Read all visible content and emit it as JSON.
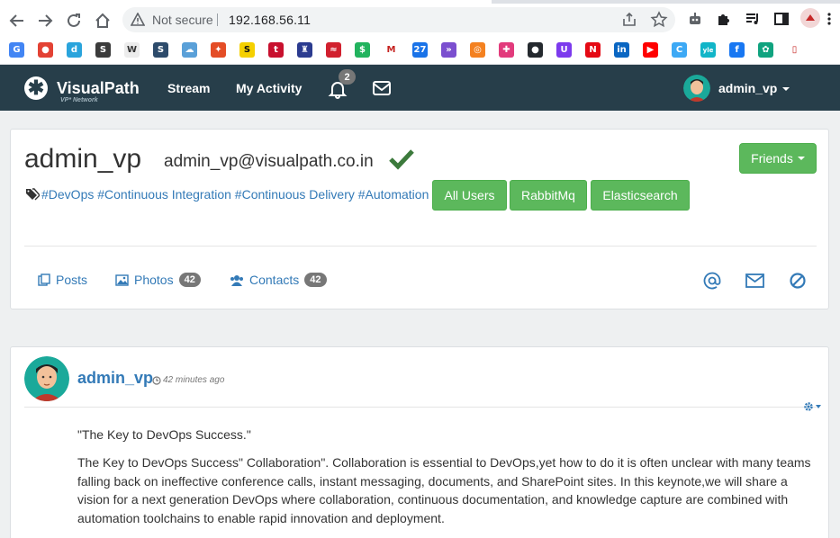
{
  "browser": {
    "security_label": "Not secure",
    "url": "192.168.56.11",
    "bookmarks": [
      {
        "icon": "google-translate-icon",
        "color": "#4285f4",
        "glyph": "G"
      },
      {
        "icon": "red-circle-icon",
        "color": "#e34234",
        "glyph": "●"
      },
      {
        "icon": "d-icon",
        "color": "#2aa4dc",
        "glyph": "d"
      },
      {
        "icon": "s-icon",
        "color": "#3b3b3b",
        "glyph": "S"
      },
      {
        "icon": "w-icon",
        "color": "#ececec",
        "glyph": "W"
      },
      {
        "icon": "stackshare-icon",
        "color": "#2d4b6b",
        "glyph": "S"
      },
      {
        "icon": "cloud-icon",
        "color": "#5aa0d8",
        "glyph": "☁"
      },
      {
        "icon": "leaf-icon",
        "color": "#e44d26",
        "glyph": "✦"
      },
      {
        "icon": "s-yellow-icon",
        "color": "#f5d000",
        "glyph": "S"
      },
      {
        "icon": "tt-icon",
        "color": "#c8102e",
        "glyph": "t"
      },
      {
        "icon": "chess-icon",
        "color": "#2b3b8f",
        "glyph": "♜"
      },
      {
        "icon": "red-wave-icon",
        "color": "#d1202e",
        "glyph": "≈"
      },
      {
        "icon": "dollar-icon",
        "color": "#22b35e",
        "glyph": "$"
      },
      {
        "icon": "gmail-icon",
        "color": "#ffffff",
        "glyph": "M"
      },
      {
        "icon": "calendar-icon",
        "color": "#1a73e8",
        "glyph": "27"
      },
      {
        "icon": "chevrons-icon",
        "color": "#7b4fcf",
        "glyph": "»"
      },
      {
        "icon": "orange-cloud-icon",
        "color": "#f48120",
        "glyph": "◎"
      },
      {
        "icon": "puzzle-bookmark-icon",
        "color": "#e23b7c",
        "glyph": "✚"
      },
      {
        "icon": "github-icon",
        "color": "#24292e",
        "glyph": "●"
      },
      {
        "icon": "u-icon",
        "color": "#7c3aed",
        "glyph": "U"
      },
      {
        "icon": "netflix-icon",
        "color": "#e50914",
        "glyph": "N"
      },
      {
        "icon": "linkedin-icon",
        "color": "#0a66c2",
        "glyph": "in"
      },
      {
        "icon": "youtube-icon",
        "color": "#ff0000",
        "glyph": "▶"
      },
      {
        "icon": "c-icon",
        "color": "#3da9f5",
        "glyph": "C"
      },
      {
        "icon": "yle-icon",
        "color": "#11b5c8",
        "glyph": "yle"
      },
      {
        "icon": "facebook-icon",
        "color": "#1877f2",
        "glyph": "f"
      },
      {
        "icon": "openai-icon",
        "color": "#10a37f",
        "glyph": "✿"
      },
      {
        "icon": "doc-icon",
        "color": "#ffffff",
        "glyph": "▯"
      }
    ]
  },
  "site": {
    "brand": "VisualPath",
    "brand_sub": "VP* Network",
    "nav": {
      "stream": "Stream",
      "activity": "My Activity"
    },
    "notification_count": "2",
    "username": "admin_vp"
  },
  "profile": {
    "name": "admin_vp",
    "email": "admin_vp@visualpath.co.in",
    "friends_label": "Friends",
    "tags": "#DevOps #Continuous Integration #Continuous Delivery #Automation",
    "tag_buttons": [
      "All Users",
      "RabbitMq",
      "Elasticsearch"
    ],
    "tabs": {
      "posts": "Posts",
      "photos": "Photos",
      "photos_count": "42",
      "contacts": "Contacts",
      "contacts_count": "42"
    }
  },
  "post": {
    "author": "admin_vp",
    "time": "42 minutes ago",
    "title": "\"The Key to DevOps Success.\"",
    "body": "The Key to DevOps Success\" Collaboration\". Collaboration is essential to DevOps,yet how to do it is often unclear with many teams falling back on ineffective conference calls, instant messaging, documents, and SharePoint sites. In this keynote,we will share a vision for a next generation DevOps where collaboration, continuous documentation, and knowledge capture are combined with automation toolchains to enable rapid innovation and deployment."
  },
  "colors": {
    "navbar": "#273e4a",
    "success": "#5cb85c",
    "link": "#337ab7",
    "badge": "#777777"
  }
}
